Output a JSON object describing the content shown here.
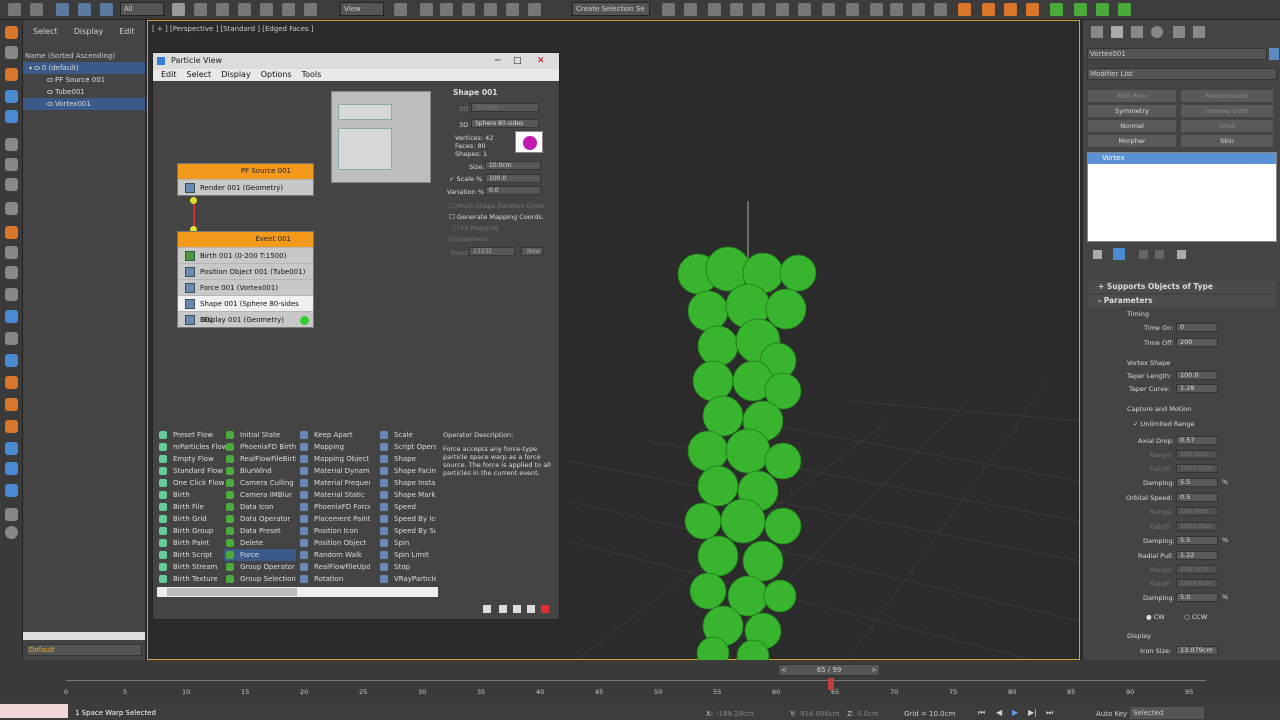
{
  "toolbar": {
    "filter": "All",
    "view": "View",
    "named_selection": "Create Selection Se"
  },
  "scene_explorer": {
    "menu": [
      "Select",
      "Display",
      "Edit"
    ],
    "header": "Name (Sorted Ascending)",
    "items": [
      {
        "label": "0 (default)",
        "selected": true
      },
      {
        "label": "PF Source 001"
      },
      {
        "label": "Tube001"
      },
      {
        "label": "Vortex001",
        "selected": true
      }
    ],
    "layer": "Default"
  },
  "viewport": {
    "label": "[ + ] [Perspective ] [Standard ] [Edged Faces ]"
  },
  "particle_view": {
    "title": "Particle View",
    "menu": [
      "Edit",
      "Select",
      "Display",
      "Options",
      "Tools"
    ],
    "source_node": {
      "title": "PF Source 001",
      "rows": [
        "Render 001 (Geometry)"
      ]
    },
    "event_node": {
      "title": "Event 001",
      "rows": [
        "Birth 001 (0-200 T:1500)",
        "Position Object 001 (Tube001)",
        "Force 001 (Vortex001)",
        "Shape 001 (Sphere 80-sides 3D)",
        "Display 001 (Geometry)"
      ]
    },
    "params": {
      "title": "Shape 001",
      "mode2d": "2D",
      "type2d": "Triangle",
      "mode3d": "3D",
      "type3d": "Sphere 80-sides",
      "vertices": "Vertices: 42",
      "faces": "Faces: 80",
      "shapes": "Shapes: 1",
      "size_label": "Size:",
      "size": "10.0cm",
      "scale_label": "Scale %",
      "scale": "100.0",
      "variation_label": "Variation %",
      "variation": "0.0",
      "multi": "Multi-Shape Random Order",
      "gen_map": "Generate Mapping Coords.",
      "fit": "Fit Mapping",
      "uniq": "Uniqueness",
      "seed_label": "Seed:",
      "seed": "23232",
      "new": "New"
    },
    "depot": {
      "col1": [
        "Preset Flow",
        "mParticles Flow",
        "Empty Flow",
        "Standard Flow",
        "One Click Flow",
        "Birth",
        "Birth File",
        "Birth Grid",
        "Birth Group",
        "Birth Paint",
        "Birth Script",
        "Birth Stream",
        "Birth Texture"
      ],
      "col2": [
        "Initial State",
        "PhoenixFD Birth",
        "RealFlowFileBirth",
        "BlurWind",
        "Camera Culling",
        "Camera IMBlur",
        "Data Icon",
        "Data Operator",
        "Data Preset",
        "Delete",
        "Force",
        "Group Operator",
        "Group Selection"
      ],
      "col3": [
        "Keep Apart",
        "Mapping",
        "Mapping Object",
        "Material Dynamic",
        "Material Frequency",
        "Material Static",
        "PhoenixFD Force",
        "Placement Paint",
        "Position Icon",
        "Position Object",
        "Random Walk",
        "RealFlowFileUpdate",
        "Rotation"
      ],
      "col4": [
        "Scale",
        "Script Operator",
        "Shape",
        "Shape Facing",
        "Shape Instance",
        "Shape Mark",
        "Speed",
        "Speed By Icon",
        "Speed By Surface",
        "Spin",
        "Spin Limit",
        "Stop",
        "VRayParticleObject"
      ],
      "selected": "Force"
    },
    "description_title": "Operator Description:",
    "description": "Force accepts any force-type particle space warp as a force source. The force is applied to all particles in the current event."
  },
  "command_panel": {
    "object_name": "Vortex001",
    "modifier_list": "Modifier List",
    "buttons": [
      [
        "Edit Poly",
        "MeshSmooth"
      ],
      [
        "Symmetry",
        "Unwrap UVW"
      ],
      [
        "Normal",
        "Shell"
      ],
      [
        "Morpher",
        "Skin"
      ]
    ],
    "stack_item": "Vortex",
    "rollout1": "Supports Objects of Type",
    "rollout2": "Parameters",
    "timing": "Timing",
    "time_on_label": "Time On:",
    "time_on": "0",
    "time_off_label": "Time Off:",
    "time_off": "200",
    "vortex_shape": "Vortex Shape",
    "taper_length_label": "Taper Length:",
    "taper_length": "100.0",
    "taper_curve_label": "Taper Curve:",
    "taper_curve": "1.28",
    "capture": "Capture and Motion",
    "unlimited": "Unlimited Range",
    "axial_drop_label": "Axial Drop:",
    "axial_drop": "0.57",
    "range1_label": "Range:",
    "range1": "100.0cm",
    "falloff1_label": "Falloff:",
    "falloff1": "1000.0cm",
    "damping1_label": "Damping:",
    "damping1": "5.5",
    "orbital_label": "Orbital Speed:",
    "orbital": "0.5",
    "range2_label": "Range:",
    "range2": "100.0cm",
    "falloff2_label": "Falloff:",
    "falloff2": "1000.0cm",
    "damping2_label": "Damping:",
    "damping2": "5.5",
    "radial_label": "Radial Pull:",
    "radial": "1.22",
    "range3_label": "Range:",
    "range3": "100.0cm",
    "falloff3_label": "Falloff:",
    "falloff3": "1000.0cm",
    "damping3_label": "Damping:",
    "damping3": "5.0",
    "percent": "%",
    "cw": "CW",
    "ccw": "CCW",
    "display": "Display",
    "icon_size_label": "Icon Size:",
    "icon_size": "13.079cm"
  },
  "timeline": {
    "frame": "65 / 99",
    "ticks": [
      "0",
      "5",
      "10",
      "15",
      "20",
      "25",
      "30",
      "35",
      "40",
      "45",
      "50",
      "55",
      "60",
      "65",
      "70",
      "75",
      "80",
      "85",
      "90",
      "95"
    ]
  },
  "status": {
    "message": "1 Space Warp Selected",
    "x_label": "X:",
    "x": "-189.29cm",
    "y_label": "Y:",
    "y": "914.806cm",
    "z_label": "Z:",
    "z": "0.0cm",
    "grid": "Grid = 10.0cm",
    "auto_key": "Auto Key",
    "selected": "Selected"
  }
}
